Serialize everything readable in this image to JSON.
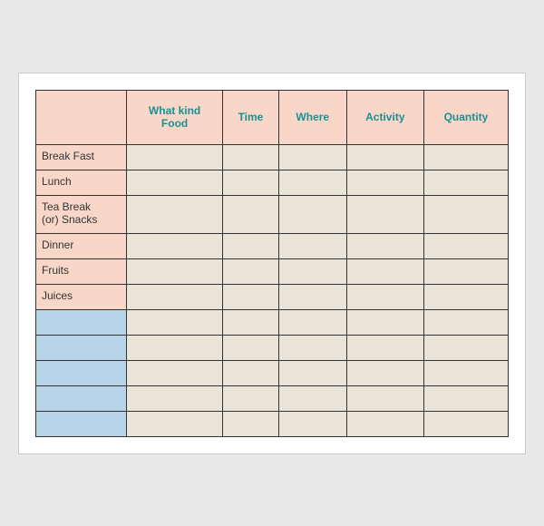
{
  "table": {
    "headers": [
      {
        "id": "label",
        "text": ""
      },
      {
        "id": "food",
        "text": "What kind\nFood"
      },
      {
        "id": "time",
        "text": "Time"
      },
      {
        "id": "where",
        "text": "Where"
      },
      {
        "id": "activity",
        "text": "Activity"
      },
      {
        "id": "quantity",
        "text": "Quantity"
      }
    ],
    "rows": [
      {
        "label": "Break Fast",
        "type": "named"
      },
      {
        "label": "Lunch",
        "type": "named"
      },
      {
        "label": "Tea Break\n(or) Snacks",
        "type": "named-tall"
      },
      {
        "label": "Dinner",
        "type": "named"
      },
      {
        "label": "Fruits",
        "type": "named"
      },
      {
        "label": "Juices",
        "type": "named"
      },
      {
        "label": "",
        "type": "blue"
      },
      {
        "label": "",
        "type": "blue"
      },
      {
        "label": "",
        "type": "blue"
      },
      {
        "label": "",
        "type": "blue"
      },
      {
        "label": "",
        "type": "blue"
      }
    ]
  }
}
